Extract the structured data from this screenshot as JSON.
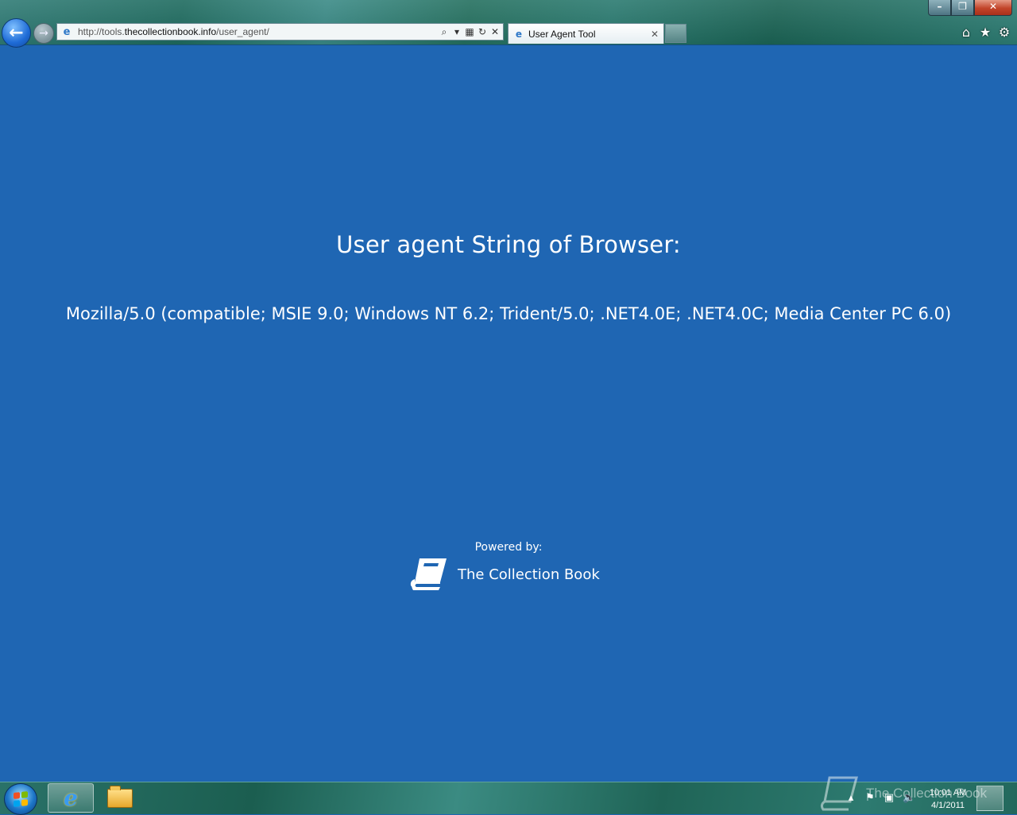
{
  "browser": {
    "address_prefix": "http://tools.",
    "address_host": "thecollectionbook.info",
    "address_path": "/user_agent/",
    "tab_title": "User Agent Tool",
    "icons": {
      "back": "back-arrow-icon",
      "forward": "forward-arrow-icon",
      "search": "search-icon",
      "compat": "compatibility-view-icon",
      "refresh": "refresh-icon",
      "stop": "stop-icon",
      "home": "home-icon",
      "favorites": "star-icon",
      "tools": "gear-icon"
    }
  },
  "page": {
    "heading": "User agent String of Browser:",
    "ua_string": "Mozilla/5.0 (compatible; MSIE 9.0; Windows NT 6.2; Trident/5.0; .NET4.0E; .NET4.0C; Media Center PC 6.0)",
    "powered_label": "Powered by:",
    "brand_name": "The Collection Book",
    "background_color": "#1f66b3"
  },
  "taskbar": {
    "watermark_text": "The Collection Book",
    "clock_time": "10:01 AM",
    "clock_date": "4/1/2011"
  }
}
